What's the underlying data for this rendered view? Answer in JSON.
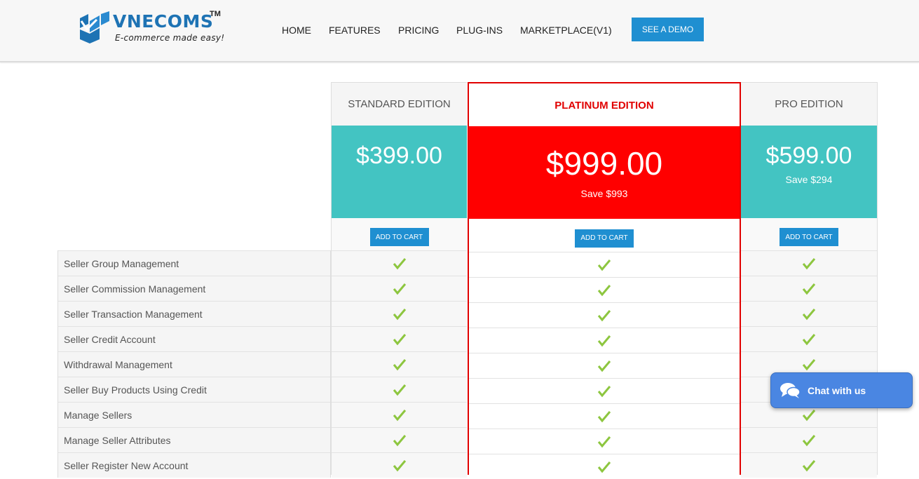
{
  "header": {
    "logo_name": "VNECOMS",
    "logo_tm": "TM",
    "logo_tagline": "E-commerce made easy!",
    "nav": [
      {
        "label": "HOME"
      },
      {
        "label": "FEATURES"
      },
      {
        "label": "PRICING"
      },
      {
        "label": "PLUG-INS"
      },
      {
        "label": "MARKETPLACE(V1)"
      }
    ],
    "demo_label": "SEE A DEMO",
    "brand_color": "#1f8fd1"
  },
  "plans": [
    {
      "name": "STANDARD EDITION",
      "price": "$399.00",
      "save": "",
      "cart_label": "ADD TO CART",
      "color": "#43c4c2"
    },
    {
      "name": "PLATINUM EDITION",
      "price": "$999.00",
      "save": "Save $993",
      "cart_label": "ADD TO CART",
      "color": "#ff0000"
    },
    {
      "name": "PRO EDITION",
      "price": "$599.00",
      "save": "Save $294",
      "cart_label": "ADD TO CART",
      "color": "#43c4c2"
    }
  ],
  "features": [
    "Seller Group Management",
    "Seller Commission Management",
    "Seller Transaction Management",
    "Seller Credit Account",
    "Withdrawal Management",
    "Seller Buy Products Using Credit",
    "Manage Sellers",
    "Manage Seller Attributes",
    "Seller Register New Account"
  ],
  "check_icon": "check-icon",
  "check_color": "#8dc63f",
  "chat": {
    "label": "Chat with us",
    "icon": "chat-bubbles-icon"
  }
}
